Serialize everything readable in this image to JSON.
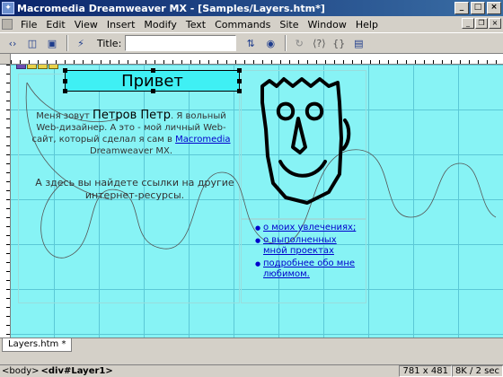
{
  "window": {
    "title": "Macromedia Dreamweaver MX - [Samples/Layers.htm*]"
  },
  "menu": [
    "File",
    "Edit",
    "View",
    "Insert",
    "Modify",
    "Text",
    "Commands",
    "Site",
    "Window",
    "Help"
  ],
  "toolbar": {
    "title_label": "Title:",
    "title_value": ""
  },
  "page": {
    "heading": "Привет",
    "intro_prefix": "Меня зовут ",
    "intro_name": "Петров Петр",
    "intro_mid": ". Я вольный Web-дизайнер. А это - мой личный Web-сайт, который сделал я сам в ",
    "intro_link": "Macromedia",
    "intro_suffix": " Dreamweaver MX.",
    "links_intro": "А здесь вы найдете ссылки на другие интернет-ресурсы.",
    "links": [
      "о моих увлечениях;",
      "о выполненных мной проектах",
      "подробнее обо мне любимом."
    ]
  },
  "doc_tab": "Layers.htm *",
  "status": {
    "tag_body": "<body>",
    "tag_div": "<div#Layer1>",
    "size": "781 x 481",
    "download": "8K / 2 sec"
  }
}
